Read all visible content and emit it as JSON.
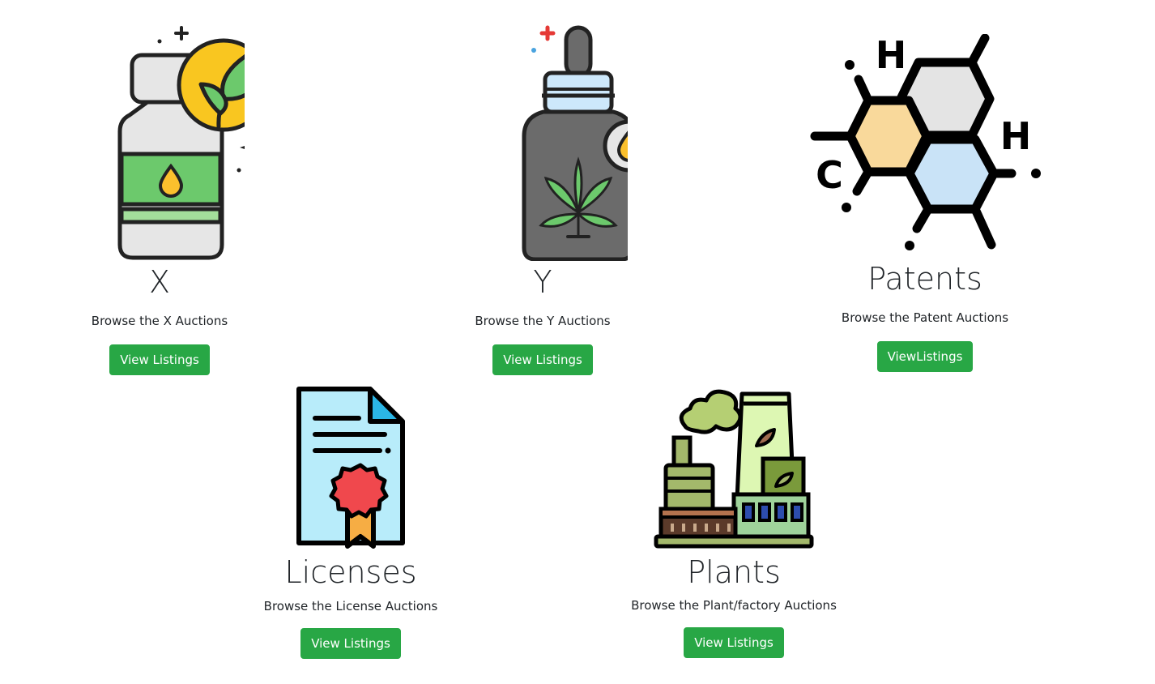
{
  "cards": [
    {
      "title": "X",
      "description": "Browse the X Auctions",
      "button_label": "View Listings",
      "icon": "supplement-bottle-leaf-icon"
    },
    {
      "title": "Y",
      "description": "Browse the Y Auctions",
      "button_label": "View Listings",
      "icon": "cannabis-oil-dropper-bottle-icon"
    },
    {
      "title": "Patents",
      "description": "Browse the Patent Auctions",
      "button_label": "ViewListings",
      "icon": "molecule-hexagon-icon",
      "molecule_labels": [
        "H",
        "H",
        "C"
      ]
    },
    {
      "title": "Licenses",
      "description": "Browse the License Auctions",
      "button_label": "View Listings",
      "icon": "certificate-document-icon"
    },
    {
      "title": "Plants",
      "description": "Browse the Plant/factory Auctions",
      "button_label": "View Listings",
      "icon": "factory-plant-icon"
    }
  ],
  "colors": {
    "button_green": "#28a745",
    "text_dark": "#212529",
    "leaf_green": "#6cc96c",
    "badge_yellow": "#f9c620",
    "drop_yellow": "#fbc02d",
    "hex_orange": "#f9d99b",
    "hex_gray": "#e4e4e4",
    "hex_blue": "#c9e3f7",
    "doc_blue": "#b8ecfa",
    "seal_red": "#f0484d",
    "ribbon_orange": "#f6ad44"
  }
}
